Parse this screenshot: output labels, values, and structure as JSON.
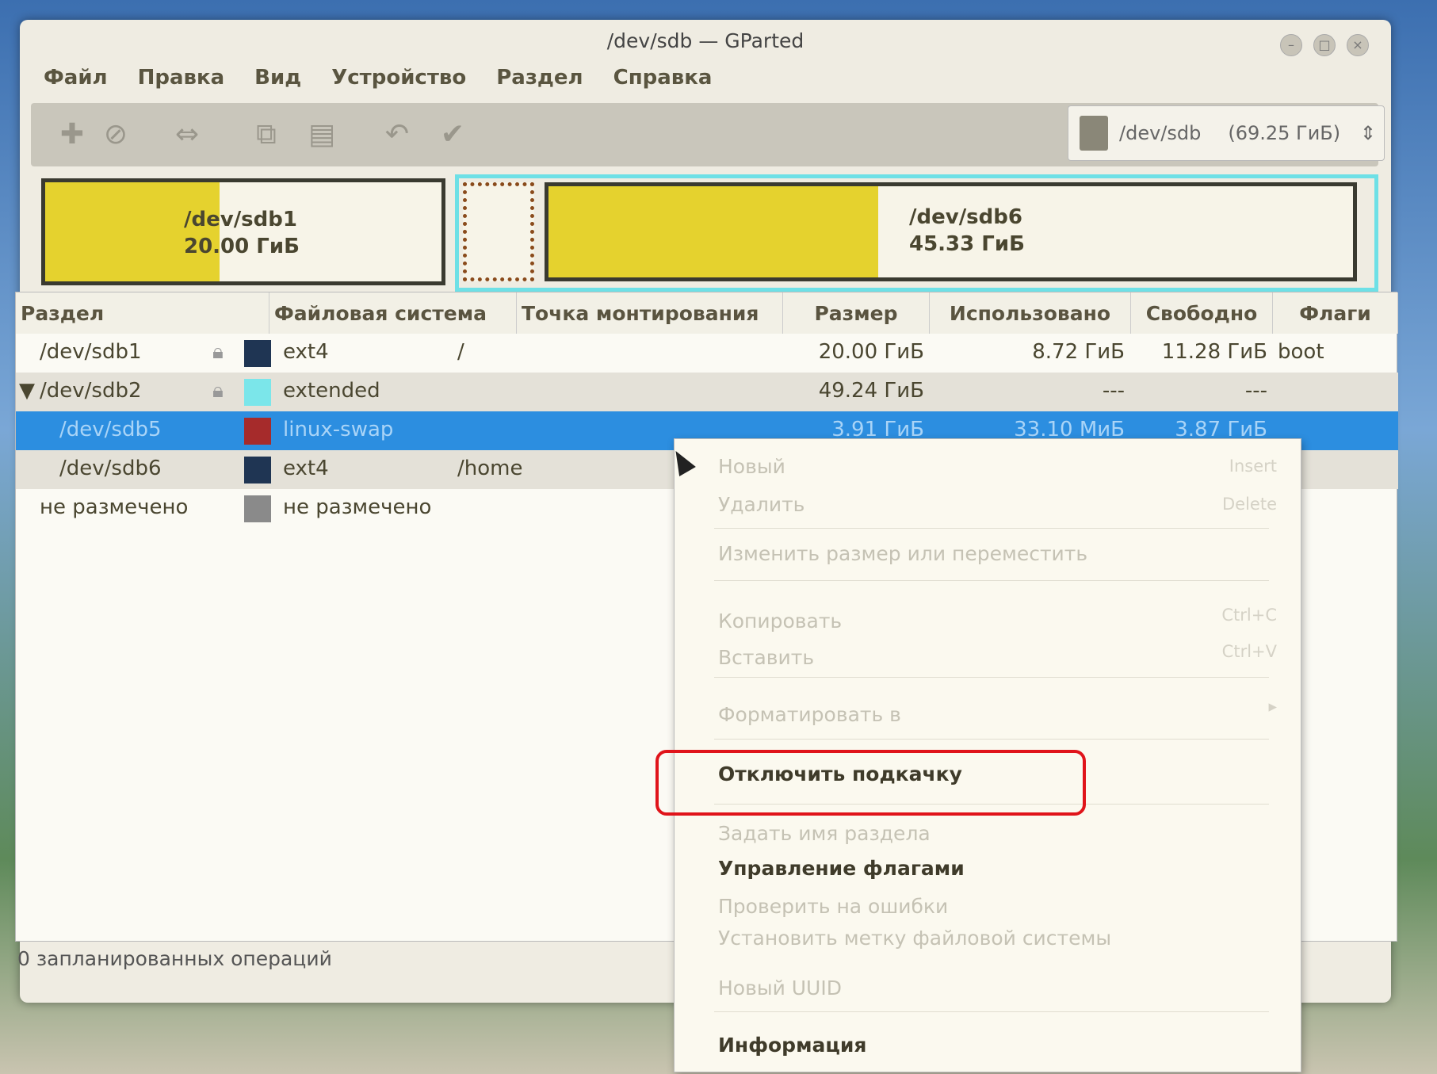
{
  "window": {
    "title": "/dev/sdb — GParted"
  },
  "menubar": [
    "Файл",
    "Правка",
    "Вид",
    "Устройство",
    "Раздел",
    "Справка"
  ],
  "device": {
    "name": "/dev/sdb",
    "size": "(69.25 ГиБ)"
  },
  "graph": {
    "sdb1": {
      "name": "/dev/sdb1",
      "size": "20.00 ГиБ",
      "used_fraction": 0.44
    },
    "sdb6": {
      "name": "/dev/sdb6",
      "size": "45.33 ГиБ",
      "used_fraction": 0.41
    }
  },
  "table": {
    "headers": [
      "Раздел",
      "Файловая система",
      "Точка монтирования",
      "Размер",
      "Использовано",
      "Свободно",
      "Флаги"
    ],
    "rows": [
      {
        "partition": "/dev/sdb1",
        "fs": "ext4",
        "fs_color": "#1f3553",
        "mount": "/",
        "size": "20.00 ГиБ",
        "used": "8.72 ГиБ",
        "free": "11.28 ГиБ",
        "flags": "boot"
      },
      {
        "partition": "/dev/sdb2",
        "fs": "extended",
        "fs_color": "#7be6ea",
        "mount": "",
        "size": "49.24 ГиБ",
        "used": "---",
        "free": "---",
        "flags": ""
      },
      {
        "partition": "/dev/sdb5",
        "fs": "linux-swap",
        "fs_color": "#a62b2b",
        "mount": "",
        "size": "3.91 ГиБ",
        "used": "33.10 МиБ",
        "free": "3.87 ГиБ",
        "flags": ""
      },
      {
        "partition": "/dev/sdb6",
        "fs": "ext4",
        "fs_color": "#1f3553",
        "mount": "/home",
        "size": "",
        "used": "",
        "free": "",
        "flags": ""
      },
      {
        "partition": "не размечено",
        "fs": "не размечено",
        "fs_color": "#8a8a8a",
        "mount": "",
        "size": "",
        "used": "",
        "free": "",
        "flags": ""
      }
    ]
  },
  "status": "0 запланированных операций",
  "context_menu": {
    "new": "Новый",
    "new_sc": "Insert",
    "delete": "Удалить",
    "delete_sc": "Delete",
    "resize": "Изменить размер или переместить",
    "copy": "Копировать",
    "copy_sc": "Ctrl+C",
    "paste": "Вставить",
    "paste_sc": "Ctrl+V",
    "format": "Форматировать в",
    "swapoff": "Отключить подкачку",
    "name": "Задать имя раздела",
    "flags": "Управление флагами",
    "check": "Проверить на ошибки",
    "label": "Установить метку файловой системы",
    "uuid": "Новый UUID",
    "info": "Информация"
  }
}
